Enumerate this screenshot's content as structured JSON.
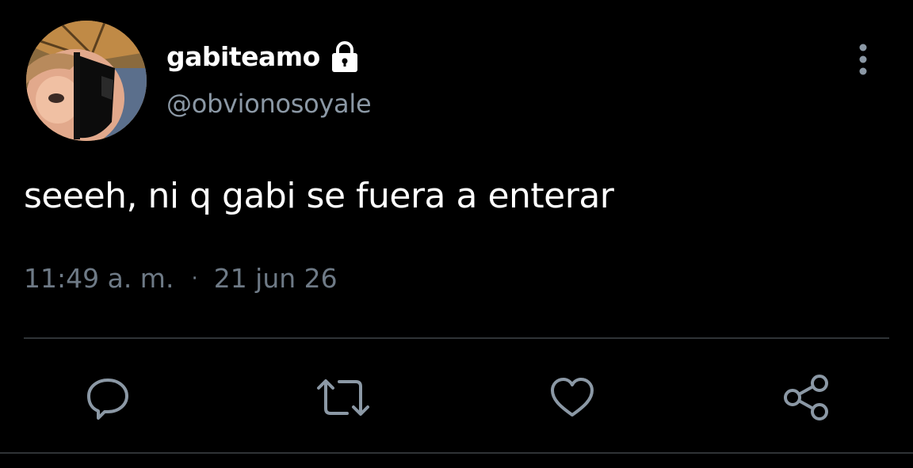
{
  "tweet": {
    "display_name": "gabiteamo",
    "handle": "@obvionosoyale",
    "text": "seeeh, ni q gabi se fuera a enterar",
    "time": "11:49 a. m.",
    "separator": "·",
    "date": "21 jun 26"
  },
  "icons": {
    "lock": "lock-icon",
    "more": "more-vertical-icon",
    "reply": "reply-icon",
    "retweet": "retweet-icon",
    "like": "heart-icon",
    "share": "share-icon"
  },
  "colors": {
    "background": "#000000",
    "primary_text": "#ffffff",
    "secondary_text": "#8b98a5",
    "action_icon": "#8b98a5",
    "divider": "#2f3336"
  }
}
